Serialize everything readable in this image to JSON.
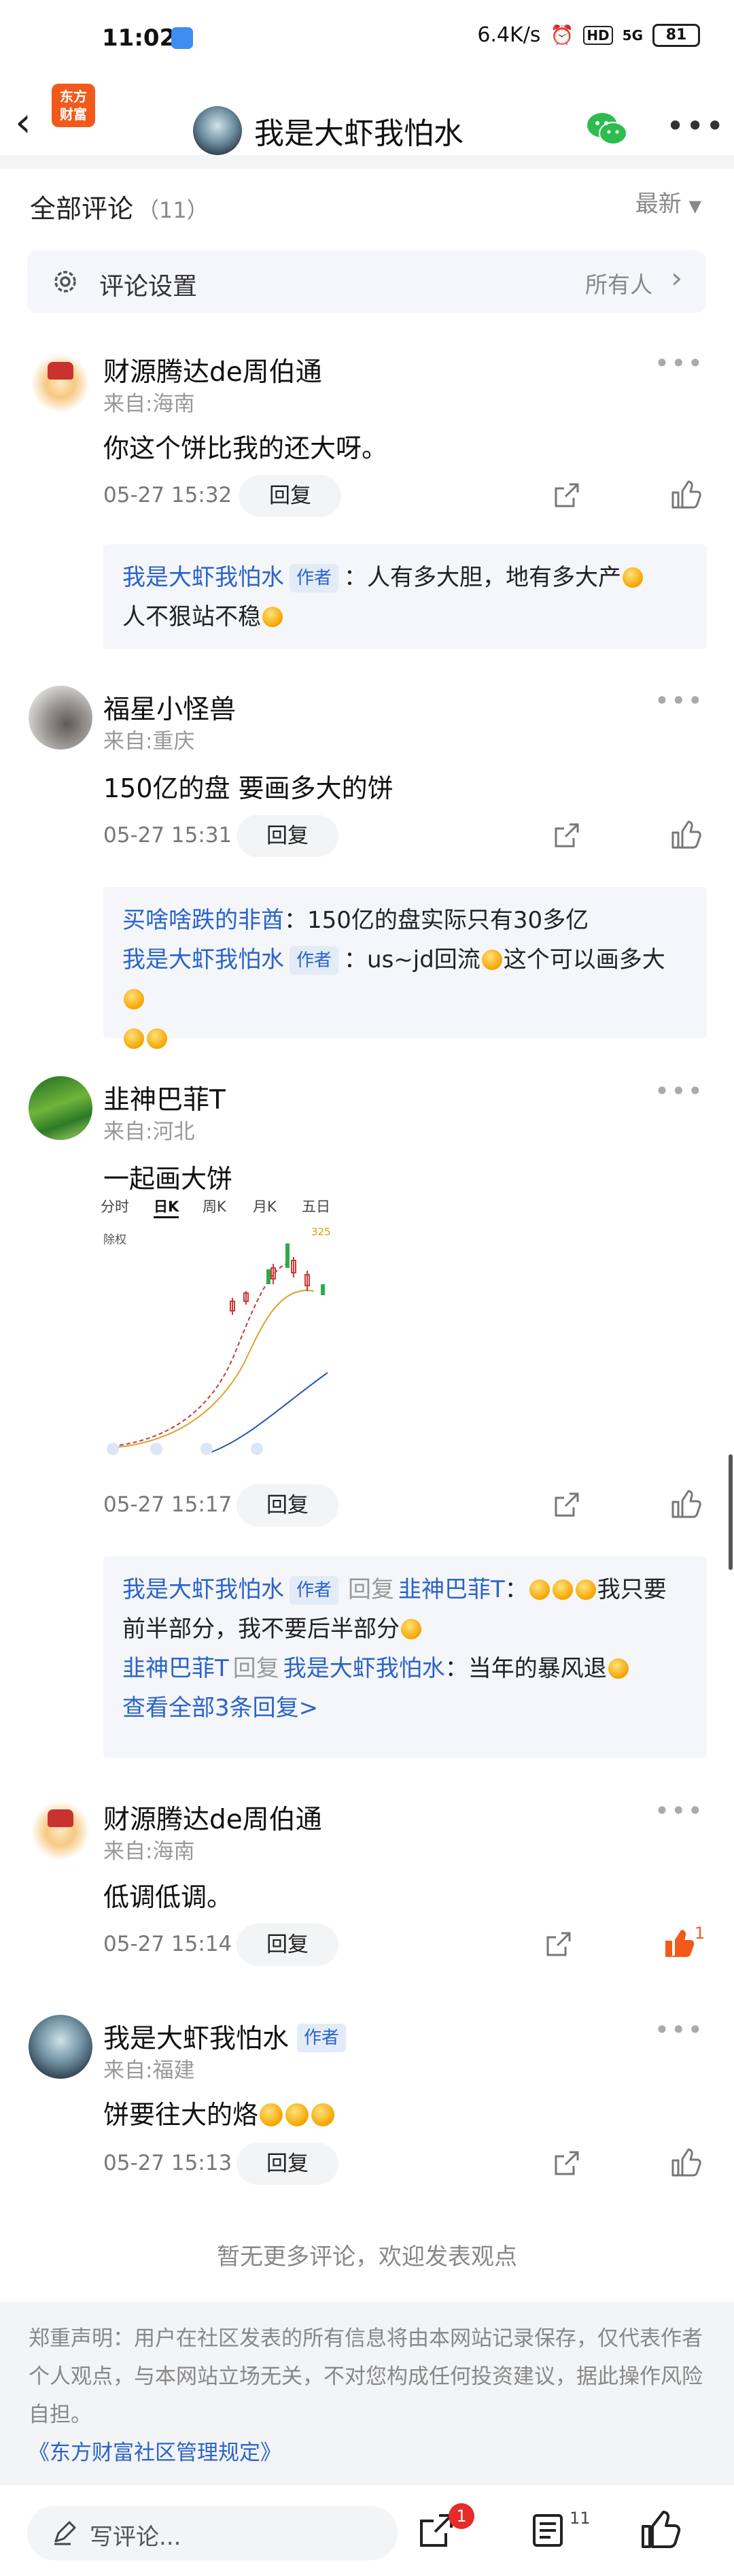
{
  "status_bar": {
    "time": "11:02",
    "speed": "6.4K/s",
    "hd": "HD",
    "signal": "5G",
    "battery": "81"
  },
  "nav": {
    "title": "我是大虾我怕水",
    "logo_line1": "东方",
    "logo_line2": "财富"
  },
  "comments_header": {
    "title": "全部评论",
    "count": "（11）",
    "sort": "最新"
  },
  "settings": {
    "label": "评论设置",
    "value": "所有人"
  },
  "labels": {
    "reply": "回复",
    "author": "作者",
    "reply_word": "回复"
  },
  "comments": [
    {
      "name": "财源腾达de周伯通",
      "location": "来自:海南",
      "text": "你这个饼比我的还大呀。",
      "time": "05-27 15:32",
      "replies": [
        {
          "user": "我是大虾我怕水",
          "text1": "：人有多大胆，地有多大产",
          "text2": "人不狠站不稳"
        }
      ]
    },
    {
      "name": "福星小怪兽",
      "location": "来自:重庆",
      "text": "150亿的盘 要画多大的饼",
      "time": "05-27 15:31",
      "replies": [
        {
          "user": "买啥啥跌的非酋",
          "text1": "：150亿的盘实际只有30多亿"
        },
        {
          "user": "我是大虾我怕水",
          "text1": "：us~jd回流",
          "text2": "这个可以画多大"
        }
      ]
    },
    {
      "name": "韭神巴菲T",
      "location": "来自:河北",
      "text": "一起画大饼",
      "time": "05-27 15:17",
      "replies": [
        {
          "user": "我是大虾我怕水",
          "target": "韭神巴菲T",
          "text1": "：",
          "text2": "我只要前半部分，我不要后半部分"
        },
        {
          "user": "韭神巴菲T",
          "target": "我是大虾我怕水",
          "text1": "：当年的暴风退"
        }
      ],
      "view_all": "查看全部3条回复>"
    },
    {
      "name": "财源腾达de周伯通",
      "location": "来自:海南",
      "text": "低调低调。",
      "time": "05-27 15:14",
      "likes": "1"
    },
    {
      "name": "我是大虾我怕水",
      "location": "来自:福建",
      "text": "饼要往大的烙",
      "time": "05-27 15:13"
    }
  ],
  "chart_thumb": {
    "tabs": [
      "分时",
      "日K",
      "周K",
      "月K",
      "五日"
    ],
    "sub_label": "除权",
    "price_label": "325"
  },
  "no_more": "暂无更多评论，欢迎发表观点",
  "disclaimer": {
    "text": "郑重声明：用户在社区发表的所有信息将由本网站记录保存，仅代表作者个人观点，与本网站立场无关，不对您构成任何投资建议，据此操作风险自担。",
    "rule_link": "《东方财富社区管理规定》"
  },
  "bottom_bar": {
    "placeholder": "写评论...",
    "share_badge": "1",
    "comment_count": "11"
  },
  "colors": {
    "link": "#2b63c9",
    "accent": "#f25a1c",
    "like_active": "#f25a1c"
  }
}
